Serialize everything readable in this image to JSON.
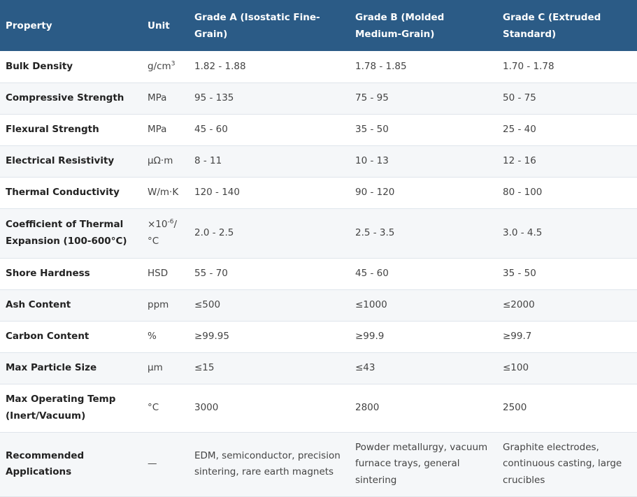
{
  "headers": {
    "property": "Property",
    "unit": "Unit",
    "grade_a": "Grade A (Isostatic Fine-Grain)",
    "grade_b": "Grade B (Molded Medium-Grain)",
    "grade_c": "Grade C (Extruded Standard)"
  },
  "rows": [
    {
      "property": "Bulk Density",
      "unit_base": "g/cm",
      "unit_sup": "3",
      "unit_tail": "",
      "a": "1.82 - 1.88",
      "b": "1.78 - 1.85",
      "c": "1.70 - 1.78"
    },
    {
      "property": "Compressive Strength",
      "unit_base": "MPa",
      "a": "95 - 135",
      "b": "75 - 95",
      "c": "50 - 75"
    },
    {
      "property": "Flexural Strength",
      "unit_base": "MPa",
      "a": "45 - 60",
      "b": "35 - 50",
      "c": "25 - 40"
    },
    {
      "property": "Electrical Resistivity",
      "unit_base": "μΩ·m",
      "a": "8 - 11",
      "b": "10 - 13",
      "c": "12 - 16"
    },
    {
      "property": "Thermal Conductivity",
      "unit_base": "W/m·K",
      "a": "120 - 140",
      "b": "90 - 120",
      "c": "80 - 100"
    },
    {
      "property": "Coefficient of Thermal Expansion (100-600°C)",
      "unit_base": "×10",
      "unit_sup": "-6",
      "unit_tail": "/°C",
      "a": "2.0 - 2.5",
      "b": "2.5 - 3.5",
      "c": "3.0 - 4.5"
    },
    {
      "property": "Shore Hardness",
      "unit_base": "HSD",
      "a": "55 - 70",
      "b": "45 - 60",
      "c": "35 - 50"
    },
    {
      "property": "Ash Content",
      "unit_base": "ppm",
      "a": "≤500",
      "b": "≤1000",
      "c": "≤2000"
    },
    {
      "property": "Carbon Content",
      "unit_base": "%",
      "a": "≥99.95",
      "b": "≥99.9",
      "c": "≥99.7"
    },
    {
      "property": "Max Particle Size",
      "unit_base": "μm",
      "a": "≤15",
      "b": "≤43",
      "c": "≤100"
    },
    {
      "property": "Max Operating Temp (Inert/Vacuum)",
      "unit_base": "°C",
      "a": "3000",
      "b": "2800",
      "c": "2500"
    },
    {
      "property": "Recommended Applications",
      "unit_base": "—",
      "a": "EDM, semiconductor, precision sintering, rare earth magnets",
      "b": "Powder metallurgy, vacuum furnace trays, general sintering",
      "c": "Graphite electrodes, continuous casting, large crucibles"
    }
  ]
}
